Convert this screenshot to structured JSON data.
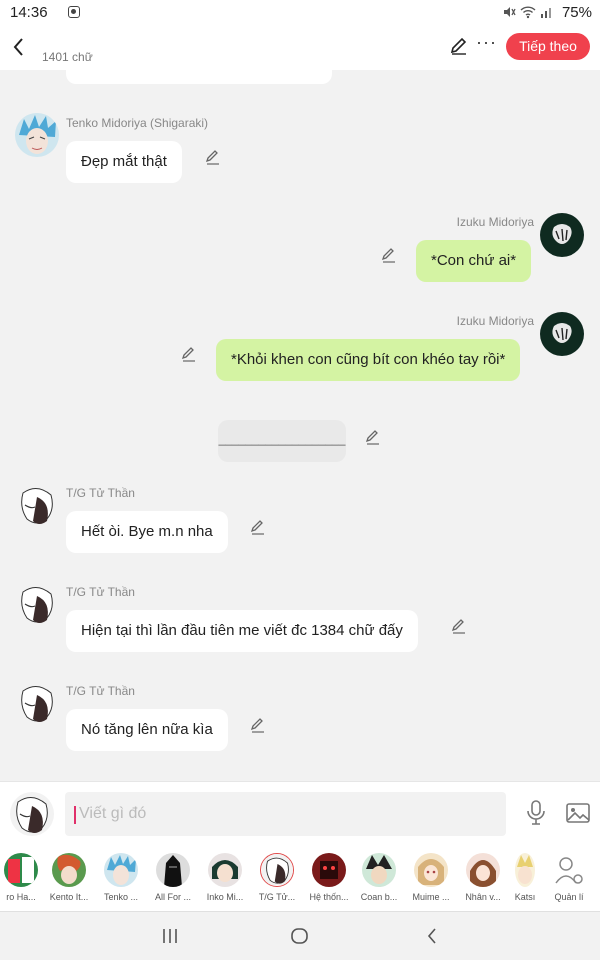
{
  "status_bar": {
    "time": "14:36",
    "battery": "75%"
  },
  "header": {
    "word_count": "1401 chữ",
    "next_label": "Tiếp theo",
    "more_label": "···"
  },
  "messages": [
    {
      "author": "Tenko Midoriya (Shigaraki)",
      "text": "Đẹp mắt thật"
    },
    {
      "author": "Izuku Midoriya",
      "text": "*Con chứ ai*"
    },
    {
      "author": "Izuku Midoriya",
      "text": "*Khỏi khen con cũng bít con khéo tay rồi*"
    },
    {
      "text": "___________________"
    },
    {
      "author": "T/G Tử Thần",
      "text": "Hết òi. Bye m.n nha"
    },
    {
      "author": "T/G Tử Thần",
      "text": "Hiện tại thì lần đầu tiên me viết đc 1384 chữ đấy"
    },
    {
      "author": "T/G Tử Thần",
      "text": "Nó tăng lên nữa kìa"
    }
  ],
  "input": {
    "placeholder": "Viết gì đó"
  },
  "characters": [
    {
      "label": "ro Ha..."
    },
    {
      "label": "Kento It..."
    },
    {
      "label": "Tenko ..."
    },
    {
      "label": "All For ..."
    },
    {
      "label": "Inko Mi..."
    },
    {
      "label": "T/G Tử..."
    },
    {
      "label": "Hệ thốn..."
    },
    {
      "label": "Coan b..."
    },
    {
      "label": "Muime ..."
    },
    {
      "label": "Nhân v..."
    },
    {
      "label": "Katsı"
    },
    {
      "label": "Quản lí"
    }
  ],
  "colors": {
    "accent": "#f0414d",
    "right_bubble": "#d4f3a3",
    "background": "#f2f2f2"
  }
}
